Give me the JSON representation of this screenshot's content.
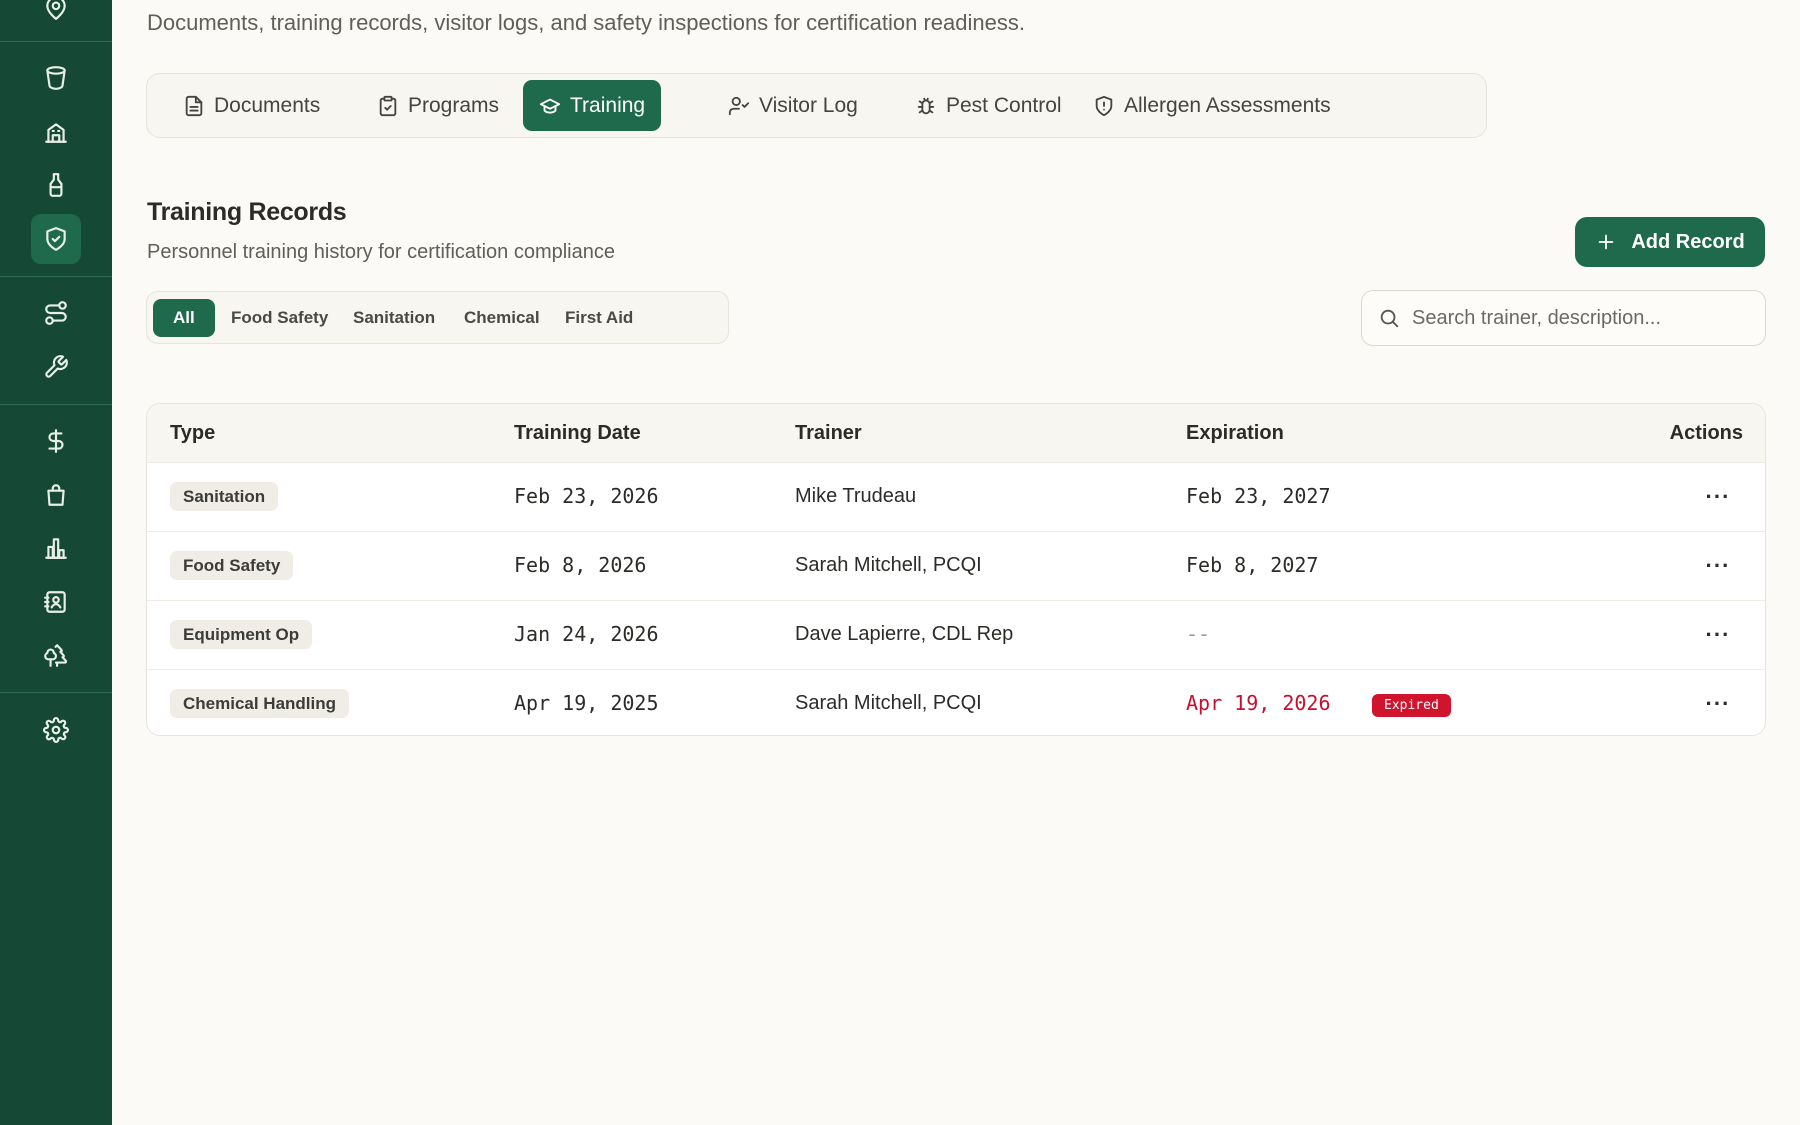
{
  "sidebar": {
    "icons": [
      {
        "name": "location-icon"
      },
      {
        "name": "cup-icon"
      },
      {
        "name": "building-icon"
      },
      {
        "name": "bottle-icon"
      },
      {
        "name": "shield-icon",
        "active": true
      },
      {
        "name": "route-icon"
      },
      {
        "name": "wrench-icon"
      },
      {
        "name": "dollar-icon"
      },
      {
        "name": "shopping-bag-icon"
      },
      {
        "name": "bar-chart-icon"
      },
      {
        "name": "contacts-book-icon"
      },
      {
        "name": "trees-icon"
      },
      {
        "name": "settings-gear-icon"
      }
    ]
  },
  "page": {
    "subtitle": "Documents, training records, visitor logs, and safety inspections for certification readiness."
  },
  "tabs": [
    {
      "label": "Documents",
      "icon": "document-icon"
    },
    {
      "label": "Programs",
      "icon": "clipboard-icon"
    },
    {
      "label": "Training",
      "icon": "graduation-cap-icon",
      "active": true
    },
    {
      "label": "Visitor Log",
      "icon": "user-check-icon"
    },
    {
      "label": "Pest Control",
      "icon": "bug-icon"
    },
    {
      "label": "Allergen Assessments",
      "icon": "shield-alert-icon"
    }
  ],
  "section": {
    "title": "Training Records",
    "description": "Personnel training history for certification compliance",
    "add_button": "Add Record"
  },
  "filters": [
    "All",
    "Food Safety",
    "Sanitation",
    "Chemical",
    "First Aid"
  ],
  "search": {
    "placeholder": "Search trainer, description..."
  },
  "table": {
    "headers": {
      "type": "Type",
      "date": "Training Date",
      "trainer": "Trainer",
      "expiration": "Expiration",
      "actions": "Actions"
    },
    "rows": [
      {
        "type": "Sanitation",
        "date": "Feb 23, 2026",
        "trainer": "Mike Trudeau",
        "expiration": "Feb 23, 2027",
        "expired": false,
        "more": "···"
      },
      {
        "type": "Food Safety",
        "date": "Feb 8, 2026",
        "trainer": "Sarah Mitchell, PCQI",
        "expiration": "Feb 8, 2027",
        "expired": false,
        "more": "···"
      },
      {
        "type": "Equipment Op",
        "date": "Jan 24, 2026",
        "trainer": "Dave Lapierre, CDL Rep",
        "expiration": "--",
        "expired": false,
        "more": "···"
      },
      {
        "type": "Chemical Handling",
        "date": "Apr 19, 2025",
        "trainer": "Sarah Mitchell, PCQI",
        "expiration": "Apr 19, 2026",
        "expired": true,
        "expired_label": "Expired",
        "more": "···"
      }
    ]
  },
  "colors": {
    "sidebar": "#154935",
    "accent": "#1f6a4c",
    "danger": "#d0142e",
    "background": "#fbfaf6"
  }
}
